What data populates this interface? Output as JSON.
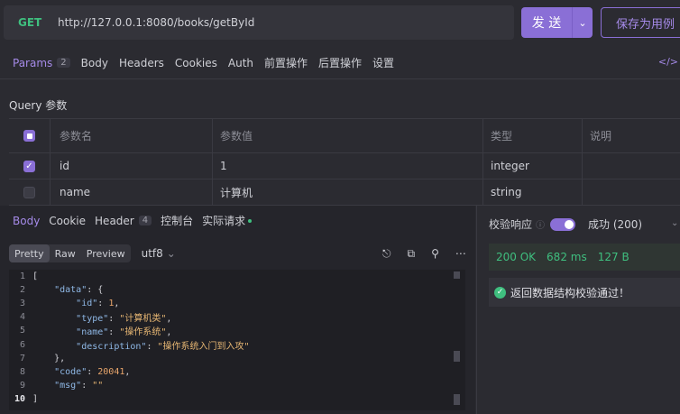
{
  "request": {
    "method": "GET",
    "url": "http://127.0.0.1:8080/books/getById",
    "send_label": "发 送",
    "save_label": "保存为用例"
  },
  "request_tabs": [
    {
      "label": "Params",
      "badge": "2",
      "active": true
    },
    {
      "label": "Body"
    },
    {
      "label": "Headers"
    },
    {
      "label": "Cookies"
    },
    {
      "label": "Auth"
    },
    {
      "label": "前置操作"
    },
    {
      "label": "后置操作"
    },
    {
      "label": "设置"
    }
  ],
  "query": {
    "title": "Query 参数",
    "headers": [
      "参数名",
      "参数值",
      "类型",
      "说明"
    ],
    "rows": [
      {
        "checked": true,
        "name": "id",
        "value": "1",
        "type": "integer",
        "desc": ""
      },
      {
        "checked": false,
        "name": "name",
        "value": "计算机",
        "type": "string",
        "desc": ""
      }
    ]
  },
  "response_tabs": [
    {
      "label": "Body",
      "active": true
    },
    {
      "label": "Cookie"
    },
    {
      "label": "Header",
      "badge": "4"
    },
    {
      "label": "控制台"
    },
    {
      "label": "实际请求"
    }
  ],
  "view_modes": [
    "Pretty",
    "Raw",
    "Preview"
  ],
  "encoding": "utf8",
  "code_lines": [
    "1",
    "2",
    "3",
    "4",
    "5",
    "6",
    "7",
    "8",
    "9",
    "10"
  ],
  "json_body": {
    "k_data": "\"data\"",
    "k_id": "\"id\"",
    "v_id": "1",
    "k_type": "\"type\"",
    "v_type": "\"计算机类\"",
    "k_name": "\"name\"",
    "v_name": "\"操作系统\"",
    "k_desc": "\"description\"",
    "v_desc": "\"操作系统入门到入攻\"",
    "k_code": "\"code\"",
    "v_code": "20041",
    "k_msg": "\"msg\"",
    "v_msg": "\"\""
  },
  "verify": {
    "label": "校验响应",
    "selected": "成功 (200)",
    "enabled": true
  },
  "status": {
    "code": "200 OK",
    "time": "682 ms",
    "size": "127 B"
  },
  "validation_message": "返回数据结构校验通过！",
  "colors": {
    "accent": "#8a6fd6",
    "success": "#3fbf7f",
    "background": "#2b2b31"
  }
}
